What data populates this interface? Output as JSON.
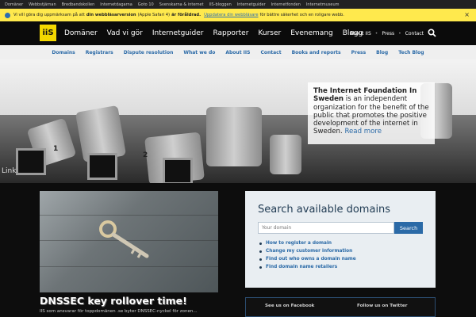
{
  "topbar": {
    "links": [
      "Domäner",
      "Webbstjärnan",
      "Bredbandskollen",
      "Internetdagarna",
      "Goto 10",
      "Svenskarna & internet",
      "IIS-bloggen",
      "Internetguider",
      "Internetfonden",
      "Internetmuseum"
    ]
  },
  "alert": {
    "text_before": "Vi vill göra dig uppmärksam på att",
    "bold_text": "din webbläsarversion",
    "middle_text": "(Apple Safari 4)",
    "bold_text2": "är föråldrad.",
    "link_text": "Uppdatera din webbläsare",
    "text_after": "för bättre säkerhet och en roligare webb.",
    "close": "×"
  },
  "mainnav": {
    "logo": "iiS",
    "items": [
      "Domäner",
      "Vad vi gör",
      "Internetguider",
      "Rapporter",
      "Kurser",
      "Evenemang",
      "Blogg"
    ],
    "right": [
      "About IIS",
      "Press",
      "Contact"
    ],
    "separator": "•",
    "search_icon": "⚲"
  },
  "subnav": {
    "items": [
      "Domains",
      "Registrars",
      "Dispute resolution",
      "What we do",
      "About IIS",
      "Contact",
      "Books and reports",
      "Press",
      "Blog",
      "Tech Blog"
    ]
  },
  "hero": {
    "port_numbers": [
      "1",
      "2"
    ],
    "side_label": "Link",
    "caption_bold": "The Internet Foundation In Sweden",
    "caption_text": "is an independent organization for the benefit of the public that promotes the positive development of the internet in Sweden.",
    "caption_link": "Read more"
  },
  "news": {
    "title": "DNSSEC key rollover time!",
    "text": "IIS som ansvarar för toppdomänen .se byter DNSSEC-nyckel för zonen..."
  },
  "domain_search": {
    "title": "Search available domains",
    "placeholder": "Your domain",
    "button": "Search",
    "links": [
      "How to register a domain",
      "Change my customer information",
      "Find out who owns a domain name",
      "Find domain name retailers"
    ]
  },
  "social": {
    "facebook": "See us on Facebook",
    "twitter": "Follow us on Twitter"
  },
  "colors": {
    "accent": "#2b6aa7",
    "logo": "#f4d800",
    "alert": "#ffe94d"
  }
}
